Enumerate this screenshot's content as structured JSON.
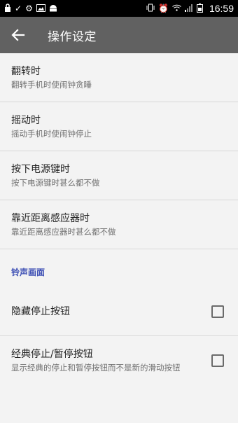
{
  "status_bar": {
    "time": "16:59",
    "left_icons": [
      "lock-icon",
      "check-icon",
      "gear-icon",
      "image-icon",
      "android-icon"
    ],
    "right_icons": [
      "vibrate-icon",
      "alarm-icon",
      "wifi-icon",
      "signal-icon",
      "battery-icon"
    ]
  },
  "app_bar": {
    "title": "操作设定",
    "background": "#616161"
  },
  "prefs": [
    {
      "title": "翻转时",
      "summary": "翻转手机时使闹钟贪睡"
    },
    {
      "title": "摇动时",
      "summary": "摇动手机时使闹钟停止"
    },
    {
      "title": "按下电源键时",
      "summary": "按下电源键时甚么都不做"
    },
    {
      "title": "靠近距离感应器时",
      "summary": "靠近距离感应器时甚么都不做"
    }
  ],
  "section": {
    "title": "铃声画面",
    "accent": "#3f51b5"
  },
  "checkbox_prefs": [
    {
      "title": "隐藏停止按钮",
      "checked": false
    },
    {
      "title": "经典停止/暂停按钮",
      "summary": "显示经典的停止和暂停按钮而不是新的滑动按钮",
      "checked": false
    }
  ]
}
